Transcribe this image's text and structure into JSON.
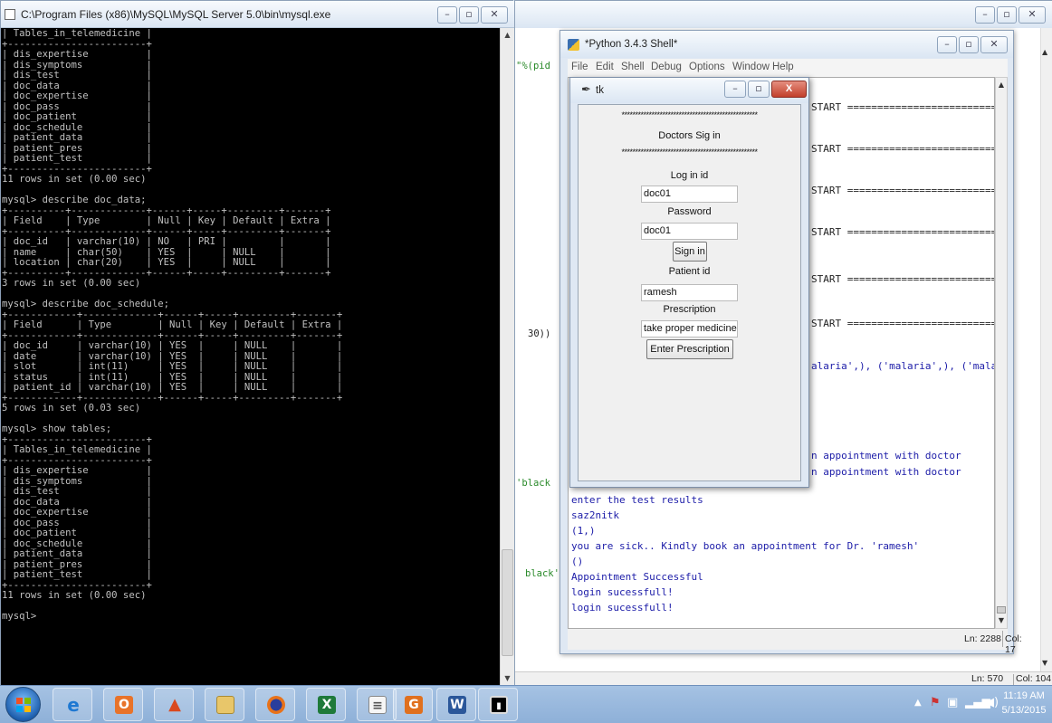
{
  "mysql_window": {
    "title": "C:\\Program Files (x86)\\MySQL\\MySQL Server 5.0\\bin\\mysql.exe",
    "console_lines": [
      "| Tables_in_telemedicine |",
      "+------------------------+",
      "| dis_expertise          |",
      "| dis_symptoms           |",
      "| dis_test               |",
      "| doc_data               |",
      "| doc_expertise          |",
      "| doc_pass               |",
      "| doc_patient            |",
      "| doc_schedule           |",
      "| patient_data           |",
      "| patient_pres           |",
      "| patient_test           |",
      "+------------------------+",
      "11 rows in set (0.00 sec)",
      "",
      "mysql> describe doc_data;",
      "+----------+-------------+------+-----+---------+-------+",
      "| Field    | Type        | Null | Key | Default | Extra |",
      "+----------+-------------+------+-----+---------+-------+",
      "| doc_id   | varchar(10) | NO   | PRI |         |       |",
      "| name     | char(50)    | YES  |     | NULL    |       |",
      "| location | char(20)    | YES  |     | NULL    |       |",
      "+----------+-------------+------+-----+---------+-------+",
      "3 rows in set (0.00 sec)",
      "",
      "mysql> describe doc_schedule;",
      "+------------+-------------+------+-----+---------+-------+",
      "| Field      | Type        | Null | Key | Default | Extra |",
      "+------------+-------------+------+-----+---------+-------+",
      "| doc_id     | varchar(10) | YES  |     | NULL    |       |",
      "| date       | varchar(10) | YES  |     | NULL    |       |",
      "| slot       | int(11)     | YES  |     | NULL    |       |",
      "| status     | int(11)     | YES  |     | NULL    |       |",
      "| patient_id | varchar(10) | YES  |     | NULL    |       |",
      "+------------+-------------+------+-----+---------+-------+",
      "5 rows in set (0.03 sec)",
      "",
      "mysql> show tables;",
      "+------------------------+",
      "| Tables_in_telemedicine |",
      "+------------------------+",
      "| dis_expertise          |",
      "| dis_symptoms           |",
      "| dis_test               |",
      "| doc_data               |",
      "| doc_expertise          |",
      "| doc_pass               |",
      "| doc_patient            |",
      "| doc_schedule           |",
      "| patient_data           |",
      "| patient_pres           |",
      "| patient_test           |",
      "+------------------------+",
      "11 rows in set (0.00 sec)",
      "",
      "mysql>"
    ]
  },
  "outer_window": {
    "fragments": [
      "\"%(pid",
      "30))",
      "'black",
      "black'"
    ],
    "status_ln": "Ln: 570",
    "status_col": "Col: 104"
  },
  "shell_window": {
    "title": "*Python 3.4.3 Shell*",
    "menu": [
      "File",
      "Edit",
      "Shell",
      "Debug",
      "Options",
      "Window",
      "Help"
    ],
    "restart_fragment": "START ===========================",
    "partial_lines": [
      "alaria',), ('malaria',), ('malar",
      "n appointment with doctor",
      "n appointment with doctor"
    ],
    "lines": [
      "enter the test results",
      "saz2nitk",
      "(1,)",
      "you are sick.. Kindly book an appointment for Dr. 'ramesh'",
      "()",
      "Appointment Successful",
      "login sucessfull!",
      "login sucessfull!"
    ],
    "status_ln": "Ln: 2288",
    "status_col": "Col: 17"
  },
  "tk_window": {
    "title": "tk",
    "stars": "**************************************************",
    "heading": "Doctors Sig in",
    "login_label": "Log in id",
    "login_value": "doc01",
    "password_label": "Password",
    "password_value": "doc01",
    "signin_label": "Sign in",
    "patient_label": "Patient id",
    "patient_value": "ramesh",
    "prescription_label": "Prescription",
    "prescription_value": "take proper medicine",
    "enter_label": "Enter Prescription"
  },
  "taskbar": {
    "apps": [
      "internet-explorer",
      "outlook",
      "matlab",
      "file-explorer",
      "firefox",
      "excel",
      "word-document",
      "pdf-reader",
      "word",
      "console"
    ],
    "time": "11:19 AM",
    "date": "5/13/2015"
  },
  "colors": {
    "console_bg": "#000000",
    "console_text": "#c0c0c0",
    "shell_output": "#1c1ca8",
    "shell_green": "#2a8a2a",
    "tk_close": "#c2402c"
  }
}
